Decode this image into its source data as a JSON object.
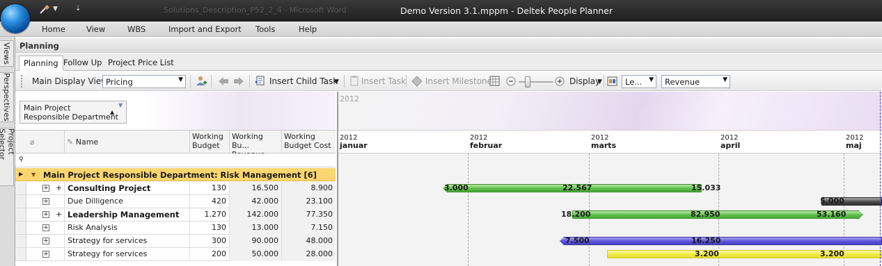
{
  "title_bar": {
    "title": "Demo Version 3.1.mppm - Deltek People Planner",
    "ghost_text": "Solutions_Description_P52_2_4 - Microsoft Word"
  },
  "menu": [
    "Home",
    "View",
    "WBS",
    "Import and Export",
    "Tools",
    "Help"
  ],
  "side_tabs": [
    "Views",
    "Perspectives",
    "Project Selector"
  ],
  "section_title": "Planning",
  "tabs": [
    "Planning",
    "Follow Up",
    "Project Price List"
  ],
  "toolbar": {
    "main_display_view_label": "Main Display View",
    "main_display_view_value": "Pricing",
    "insert_child_task": "Insert Child Task",
    "insert_task": "Insert Task",
    "insert_milestone": "Insert Milestone",
    "display": "Display",
    "level_value": "Le...",
    "measure_value": "Revenue"
  },
  "group_box": {
    "line1": "Main Project",
    "line2": "Responsible Department"
  },
  "columns": {
    "name": "Name",
    "working_budget": "Working Budget",
    "working_budget_revenue": "Working Bu... Revenue",
    "working_budget_cost": "Working Budget Cost"
  },
  "group_row": "Main Project Responsible Department: Risk Management [6]",
  "rows": [
    {
      "name": "Consulting Project",
      "bold": true,
      "plus": true,
      "budget": "130",
      "revenue": "16.500",
      "cost": "8.900"
    },
    {
      "name": "Due Dilligence",
      "bold": false,
      "plus": false,
      "budget": "420",
      "revenue": "42.000",
      "cost": "23.100"
    },
    {
      "name": "Leadership Management",
      "bold": true,
      "plus": true,
      "budget": "1.270",
      "revenue": "142.000",
      "cost": "77.350"
    },
    {
      "name": "Risk Analysis",
      "bold": false,
      "plus": false,
      "budget": "130",
      "revenue": "13.000",
      "cost": "7.150"
    },
    {
      "name": "Strategy for services",
      "bold": false,
      "plus": false,
      "budget": "300",
      "revenue": "90.000",
      "cost": "48.000"
    },
    {
      "name": "Strategy for services",
      "bold": false,
      "plus": false,
      "budget": "200",
      "revenue": "50.000",
      "cost": "28.000"
    }
  ],
  "gantt": {
    "year_band": "2012",
    "months": [
      {
        "year": "2012",
        "month": "januar"
      },
      {
        "year": "2012",
        "month": "februar"
      },
      {
        "year": "2012",
        "month": "marts"
      },
      {
        "year": "2012",
        "month": "april"
      },
      {
        "year": "2012",
        "month": "maj"
      }
    ],
    "bars": [
      {
        "row": 0,
        "labels": [
          "3.000",
          "22.567",
          "15.033"
        ]
      },
      {
        "row": 1,
        "labels": [
          "5.000"
        ]
      },
      {
        "row": 2,
        "labels": [
          "18.200",
          "82.950",
          "53.160"
        ]
      },
      {
        "row": 4,
        "labels": [
          "7.500",
          "16.250"
        ]
      },
      {
        "row": 5,
        "labels": [
          "3.200",
          "3.200"
        ]
      }
    ]
  }
}
